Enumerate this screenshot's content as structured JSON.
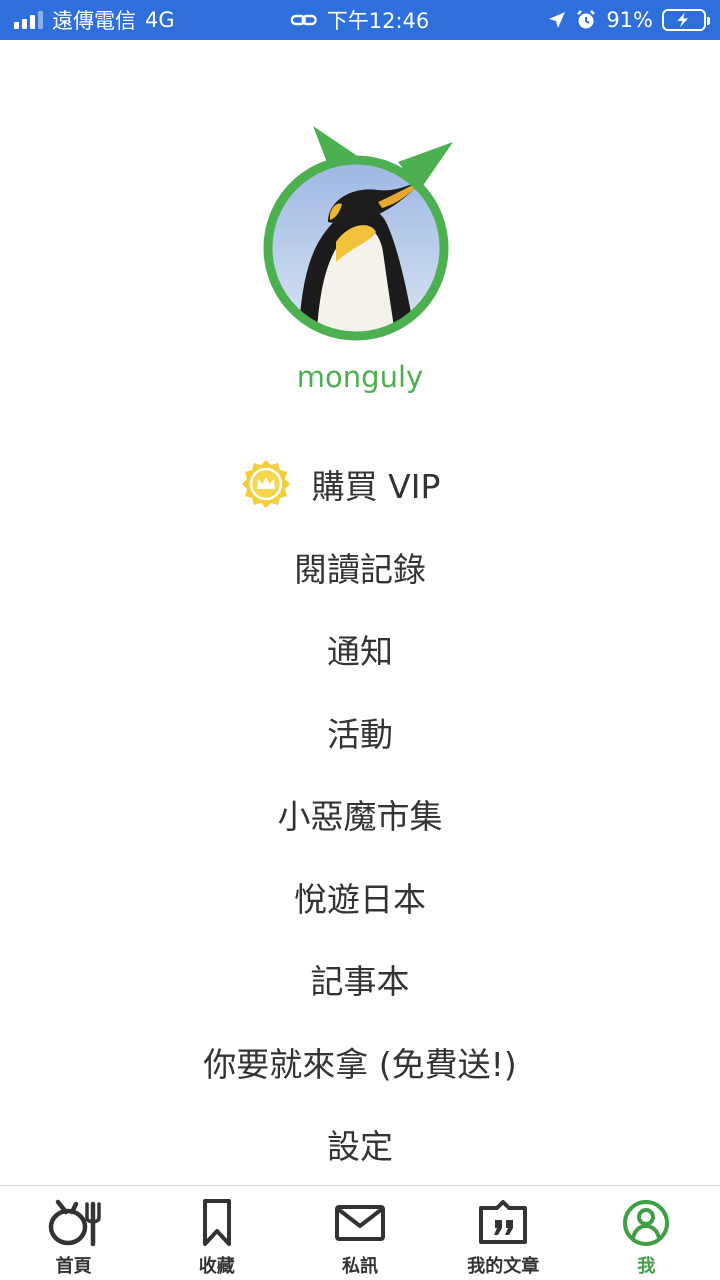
{
  "status_bar": {
    "carrier": "遠傳電信",
    "network": "4G",
    "time": "下午12:46",
    "battery": "91%",
    "battery_level": 0.91
  },
  "profile": {
    "username": "monguly",
    "avatar_icon": "penguin-avatar"
  },
  "menu": {
    "vip_label": "購買 VIP",
    "items": [
      "閱讀記錄",
      "通知",
      "活動",
      "小惡魔市集",
      "悅遊日本",
      "記事本",
      "你要就來拿 (免費送!)",
      "設定"
    ]
  },
  "tabs": [
    {
      "label": "首頁",
      "icon": "home-icon"
    },
    {
      "label": "收藏",
      "icon": "bookmark-icon"
    },
    {
      "label": "私訊",
      "icon": "mail-icon"
    },
    {
      "label": "我的文章",
      "icon": "articles-icon"
    },
    {
      "label": "我",
      "icon": "profile-icon"
    }
  ],
  "colors": {
    "status_bar": "#2f6fdb",
    "accent_green": "#4caf50",
    "vip_gold": "#f2cf3a"
  }
}
